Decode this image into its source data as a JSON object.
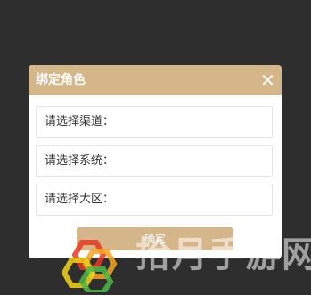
{
  "dialog": {
    "title": "绑定角色",
    "close_symbol": "✕",
    "fields": [
      {
        "label": "请选择渠道："
      },
      {
        "label": "请选择系统："
      },
      {
        "label": "请选择大区："
      }
    ],
    "confirm_label": "确定"
  },
  "watermark": {
    "text": "拾月手游网",
    "logo_icon": "hexagon-logo"
  },
  "colors": {
    "background": "#2e2e2e",
    "accent": "#d5b68a",
    "dialog_bg": "#ffffff",
    "field_border": "#e6e6e6"
  }
}
